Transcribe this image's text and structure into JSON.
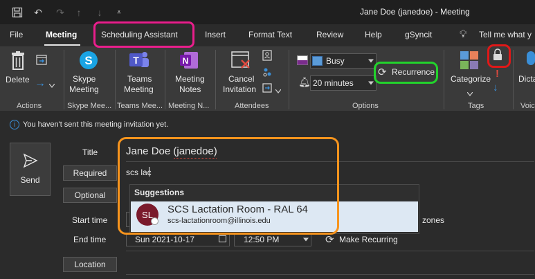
{
  "window": {
    "title": "Jane Doe (janedoe)  -  Meeting"
  },
  "menu": {
    "items": [
      "File",
      "Meeting",
      "Scheduling Assistant",
      "Insert",
      "Format Text",
      "Review",
      "Help",
      "gSyncit"
    ],
    "active": "Meeting",
    "tell_me": "Tell me what y"
  },
  "ribbon": {
    "actions": {
      "delete_label": "Delete",
      "group": "Actions"
    },
    "skype": {
      "label_1": "Skype",
      "label_2": "Meeting",
      "group": "Skype Mee..."
    },
    "teams": {
      "label_1": "Teams",
      "label_2": "Meeting",
      "group": "Teams Mee..."
    },
    "notes": {
      "label_1": "Meeting",
      "label_2": "Notes",
      "group": "Meeting N..."
    },
    "attendees": {
      "cancel_1": "Cancel",
      "cancel_2": "Invitation",
      "group": "Attendees"
    },
    "options": {
      "show_as": "Busy",
      "reminder": "20 minutes",
      "recurrence_label": "Recurrence",
      "group": "Options"
    },
    "tags": {
      "categorize_label": "Categorize",
      "group": "Tags"
    },
    "voice": {
      "dictate_label": "Dicta",
      "group": "Voic"
    }
  },
  "info": {
    "message": "You haven't sent this meeting invitation yet."
  },
  "form": {
    "send_label": "Send",
    "title_label": "Title",
    "title_value": "Jane Doe (janedoe)",
    "required_label": "Required",
    "required_value": "scs lac",
    "optional_label": "Optional",
    "start_label": "Start time",
    "end_label": "End time",
    "end_date": "Sun 2021-10-17",
    "end_time": "12:50 PM",
    "make_recurring": "Make Recurring",
    "time_zones": "zones",
    "location_label": "Location"
  },
  "suggestions": {
    "header": "Suggestions",
    "items": [
      {
        "initials": "SL",
        "name": "SCS Lactation Room - RAL 64",
        "email": "scs-lactationroom@illinois.edu"
      }
    ]
  },
  "colors": {
    "highlight_magenta": "#e91e8c",
    "highlight_green": "#22d32c",
    "highlight_red": "#e01818",
    "highlight_orange": "#f7941d",
    "avatar": "#7a1a2c",
    "accent_blue": "#3a8fd8"
  }
}
